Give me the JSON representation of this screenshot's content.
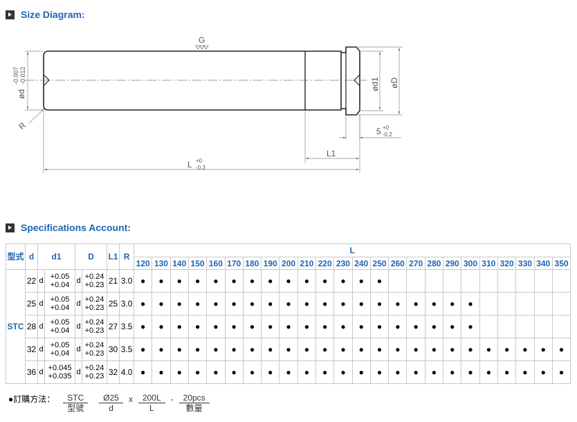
{
  "sections": {
    "size_title": "Size Diagram:",
    "spec_title": "Specifications Account:"
  },
  "diagram": {
    "g_label": "G",
    "d_label": "ød",
    "d_tol_upper": "-0.007",
    "d_tol_lower": "-0.012",
    "d1_label": "ød1",
    "D_label": "øD",
    "r_label": "R",
    "five_label": "5",
    "five_tol_upper": "+0",
    "five_tol_lower": "-0.2",
    "l1_label": "L1",
    "l_label": "L",
    "l_tol_upper": "+0",
    "l_tol_lower": "-0.3"
  },
  "table": {
    "head": {
      "type": "型式",
      "d": "d",
      "d1": "d1",
      "D": "D",
      "L1": "L1",
      "R": "R",
      "L": "L"
    },
    "lengths": [
      "120",
      "130",
      "140",
      "150",
      "160",
      "170",
      "180",
      "190",
      "200",
      "210",
      "220",
      "230",
      "240",
      "250",
      "260",
      "270",
      "280",
      "290",
      "300",
      "310",
      "320",
      "330",
      "340",
      "350"
    ],
    "type_value": "STC",
    "dot_symbol": "●",
    "rows": [
      {
        "d": "22",
        "dl": "d",
        "d1_up": "+0.05",
        "d1_lo": "+0.04",
        "Dl": "d",
        "D_up": "+0.24",
        "D_lo": "+0.23",
        "L1": "21",
        "R": "3.0",
        "count": 14
      },
      {
        "d": "25",
        "dl": "d",
        "d1_up": "+0.05",
        "d1_lo": "+0.04",
        "Dl": "d",
        "D_up": "+0.24",
        "D_lo": "+0.23",
        "L1": "25",
        "R": "3.0",
        "count": 19
      },
      {
        "d": "28",
        "dl": "d",
        "d1_up": "+0.05",
        "d1_lo": "+0.04",
        "Dl": "d",
        "D_up": "+0.24",
        "D_lo": "+0.23",
        "L1": "27",
        "R": "3.5",
        "count": 19
      },
      {
        "d": "32",
        "dl": "d",
        "d1_up": "+0.05",
        "d1_lo": "+0.04",
        "Dl": "d",
        "D_up": "+0.24",
        "D_lo": "+0.23",
        "L1": "30",
        "R": "3.5",
        "count": 24
      },
      {
        "d": "36",
        "dl": "d",
        "d1_up": "+0.045",
        "d1_lo": "+0.035",
        "Dl": "d",
        "D_up": "+0.24",
        "D_lo": "+0.23",
        "L1": "32",
        "R": "4.0",
        "count": 24
      }
    ]
  },
  "order": {
    "label": "●訂購方法：",
    "items": [
      {
        "value": "STC",
        "caption": "型號"
      },
      {
        "value": "Ø25",
        "caption": "d"
      },
      {
        "value": "200L",
        "caption": "L"
      },
      {
        "value": "20pcs",
        "caption": "數量"
      }
    ],
    "sep_x": "x",
    "sep_dash": "-"
  }
}
